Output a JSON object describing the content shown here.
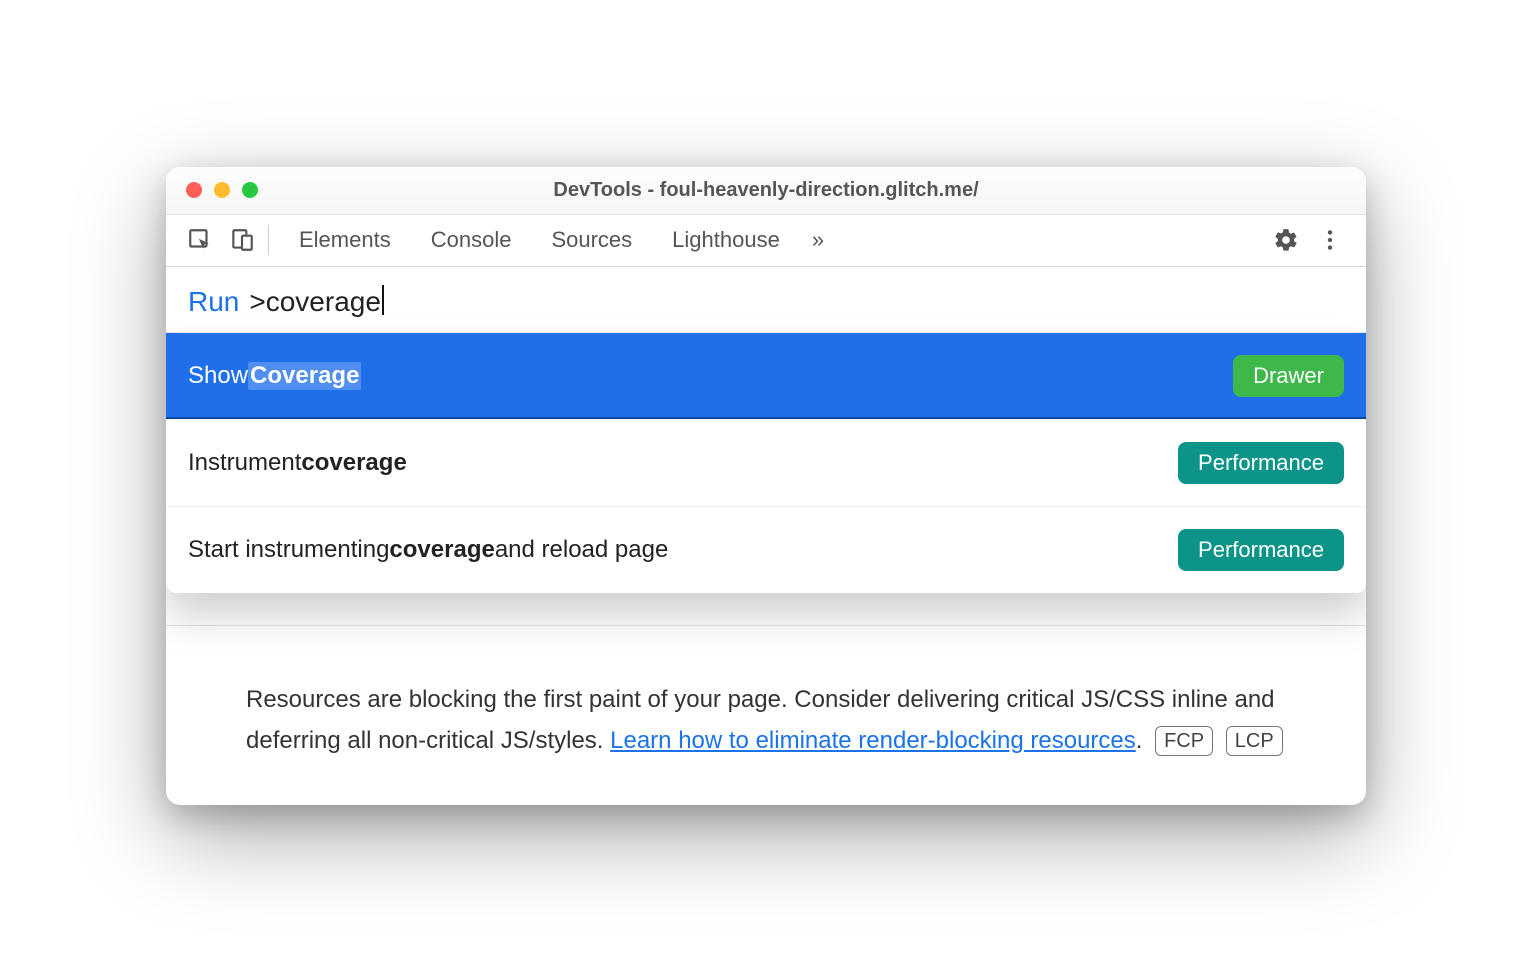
{
  "window": {
    "title": "DevTools - foul-heavenly-direction.glitch.me/"
  },
  "tabs": {
    "items": [
      "Elements",
      "Console",
      "Sources",
      "Lighthouse"
    ],
    "more_glyph": "»"
  },
  "command_menu": {
    "prefix": "Run",
    "query": ">coverage",
    "suggestions": [
      {
        "pre": "Show ",
        "match": "Coverage",
        "post": "",
        "tag_label": "Drawer",
        "tag_kind": "drawer",
        "selected": true
      },
      {
        "pre": "Instrument ",
        "match": "coverage",
        "post": "",
        "tag_label": "Performance",
        "tag_kind": "perf",
        "selected": false
      },
      {
        "pre": "Start instrumenting ",
        "match": "coverage",
        "post": " and reload page",
        "tag_label": "Performance",
        "tag_kind": "perf",
        "selected": false
      }
    ]
  },
  "hint": {
    "text_before_link": "Resources are blocking the first paint of your page. Consider delivering critical JS/CSS inline and deferring all non-critical JS/styles. ",
    "link_text": "Learn how to eliminate render-blocking resources",
    "text_after_link": ".",
    "chips": [
      "FCP",
      "LCP"
    ]
  }
}
